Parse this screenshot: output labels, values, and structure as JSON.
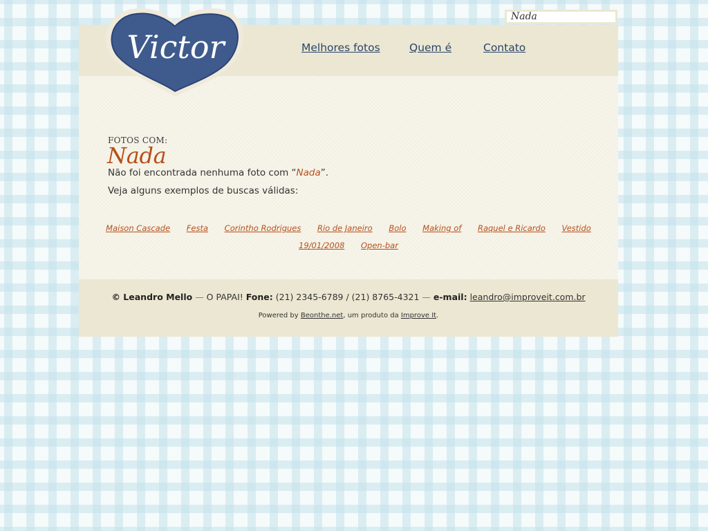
{
  "search": {
    "value": "Nada"
  },
  "logo": {
    "text": "Victor",
    "icon": "heart-logo",
    "color": "#3f5b8d"
  },
  "nav": {
    "items": [
      {
        "label": "Melhores fotos"
      },
      {
        "label": "Quem é"
      },
      {
        "label": "Contato"
      }
    ]
  },
  "main": {
    "kicker": "FOTOS COM:",
    "title": "Nada",
    "not_found_prefix": "Não foi encontrada nenhuma foto com “",
    "not_found_term": "Nada",
    "not_found_suffix": "”.",
    "examples_intro": "Veja alguns exemplos de buscas válidas:",
    "examples": [
      "Maison Cascade",
      "Festa",
      "Corintho Rodrigues",
      "Rio de Janeiro",
      "Bolo",
      "Making of",
      "Raquel e Ricardo",
      "Vestido",
      "19/01/2008",
      "Open-bar"
    ]
  },
  "footer": {
    "author": "© Leandro Mello",
    "sep1": " — ",
    "tagline": "O PAPAI!",
    "phone_label": "Fone:",
    "phones": "(21) 2345-6789 / (21) 8765-4321",
    "sep2": " — ",
    "email_label": "e-mail:",
    "email": "leandro@improveit.com.br",
    "powered_prefix": "Powered by ",
    "powered_link": "Beonthe.net",
    "powered_middle": ", um produto da ",
    "company_link": "Improve It",
    "powered_suffix": "."
  },
  "colors": {
    "accent": "#b5501b",
    "nav_link": "#2a4569",
    "panel": "#ebe7d2",
    "content_bg": "#f8f5ea"
  }
}
